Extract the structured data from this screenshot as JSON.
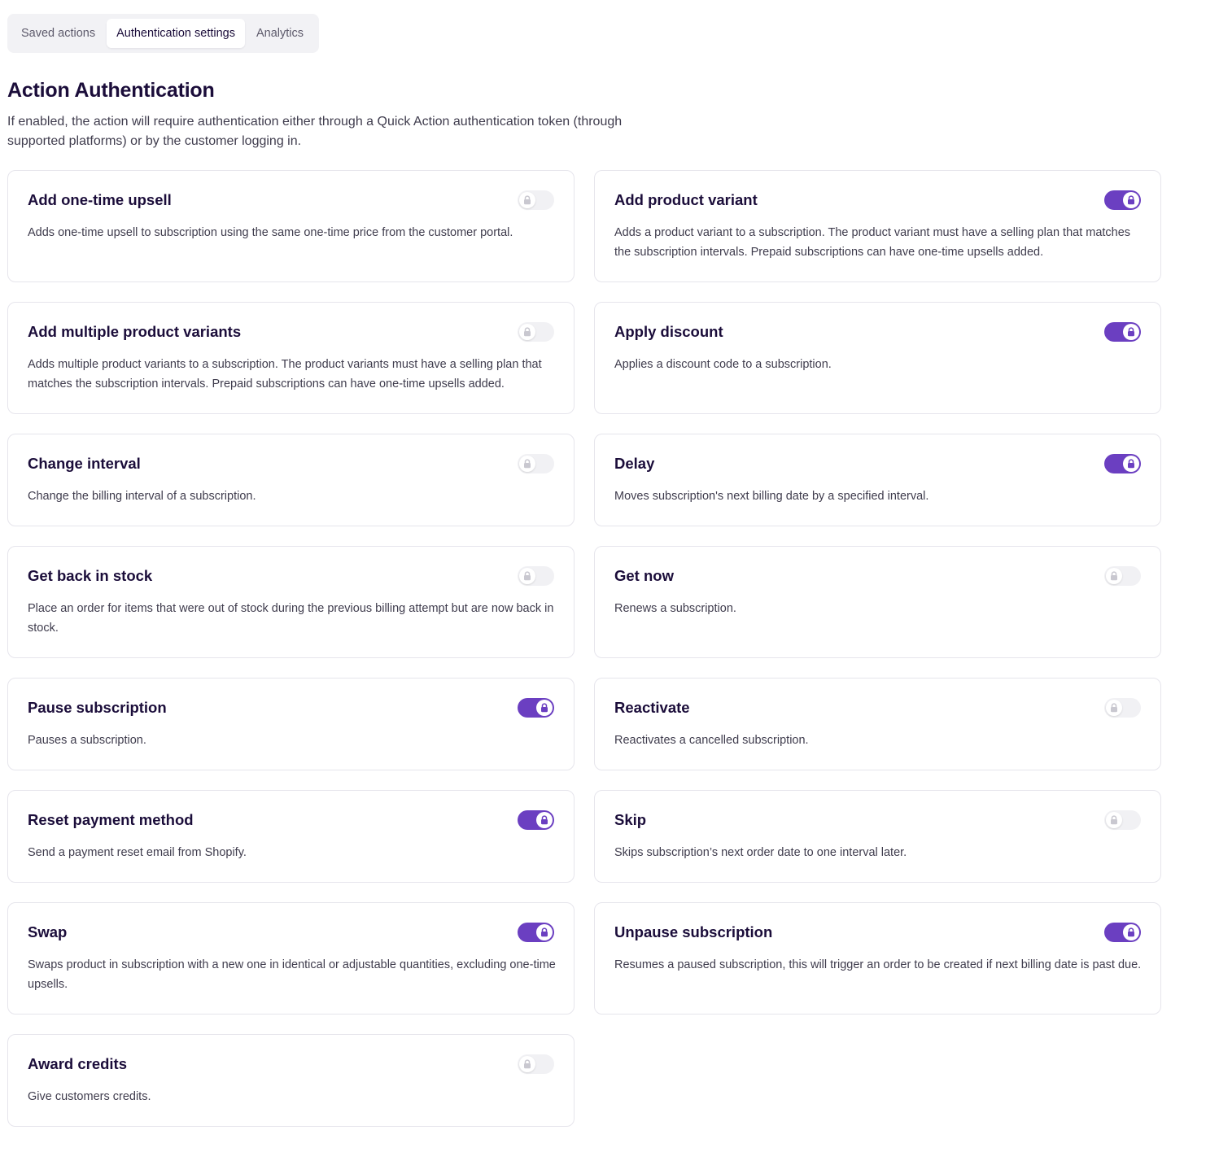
{
  "tabs": [
    {
      "label": "Saved actions",
      "active": false
    },
    {
      "label": "Authentication settings",
      "active": true
    },
    {
      "label": "Analytics",
      "active": false
    }
  ],
  "header": {
    "title": "Action Authentication",
    "description": "If enabled, the action will require authentication either through a Quick Action authentication token (through supported platforms) or by the customer logging in."
  },
  "colors": {
    "accent": "#6b3fc1",
    "toggle_off": "#f1f1f4",
    "lock_off": "#c9c8d0"
  },
  "actions": [
    {
      "title": "Add one-time upsell",
      "description": "Adds one-time upsell to subscription using the same one-time price from the customer portal.",
      "enabled": false
    },
    {
      "title": "Add product variant",
      "description": "Adds a product variant to a subscription. The product variant must have a selling plan that matches the subscription intervals. Prepaid subscriptions can have one-time upsells added.",
      "enabled": true
    },
    {
      "title": "Add multiple product variants",
      "description": "Adds multiple product variants to a subscription. The product variants must have a selling plan that matches the subscription intervals. Prepaid subscriptions can have one-time upsells added.",
      "enabled": false
    },
    {
      "title": "Apply discount",
      "description": "Applies a discount code to a subscription.",
      "enabled": true
    },
    {
      "title": "Change interval",
      "description": "Change the billing interval of a subscription.",
      "enabled": false
    },
    {
      "title": "Delay",
      "description": "Moves subscription's next billing date by a specified interval.",
      "enabled": true
    },
    {
      "title": "Get back in stock",
      "description": "Place an order for items that were out of stock during the previous billing attempt but are now back in stock.",
      "enabled": false
    },
    {
      "title": "Get now",
      "description": "Renews a subscription.",
      "enabled": false
    },
    {
      "title": "Pause subscription",
      "description": "Pauses a subscription.",
      "enabled": true
    },
    {
      "title": "Reactivate",
      "description": "Reactivates a cancelled subscription.",
      "enabled": false
    },
    {
      "title": "Reset payment method",
      "description": "Send a payment reset email from Shopify.",
      "enabled": true
    },
    {
      "title": "Skip",
      "description": "Skips subscription’s next order date to one interval later.",
      "enabled": false
    },
    {
      "title": "Swap",
      "description": "Swaps product in subscription with a new one in identical or adjustable quantities, excluding one-time upsells.",
      "enabled": true
    },
    {
      "title": "Unpause subscription",
      "description": "Resumes a paused subscription, this will trigger an order to be created if next billing date is past due.",
      "enabled": true
    },
    {
      "title": "Award credits",
      "description": "Give customers credits.",
      "enabled": false
    }
  ]
}
